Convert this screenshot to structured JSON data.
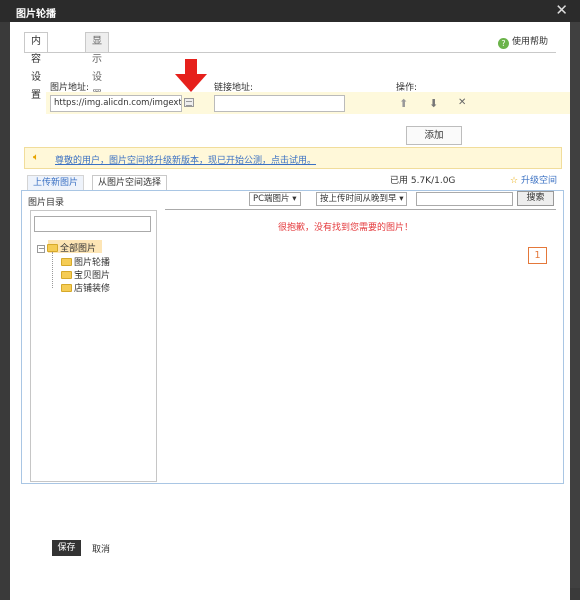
{
  "window": {
    "title": "图片轮播",
    "close_glyph": "✕"
  },
  "tabs": [
    {
      "label": "内容设置",
      "active": true
    },
    {
      "label": "显示设置",
      "active": false
    }
  ],
  "help": {
    "label": "使用帮助",
    "icon": "question-circle-icon"
  },
  "form": {
    "image_url_label": "图片地址:",
    "image_url_value": "https://img.alicdn.com/imgextra/",
    "link_url_label": "链接地址:",
    "link_url_value": "",
    "ops_label": "操作:",
    "ops": [
      {
        "name": "move-up",
        "glyph": "⬆"
      },
      {
        "name": "move-down",
        "glyph": "⬇"
      },
      {
        "name": "delete",
        "glyph": "✕"
      }
    ]
  },
  "add_button": "添加",
  "notice": {
    "text": "尊敬的用户，图片空间将升级新版本，现已开始公测，点击试用。",
    "icon": "speaker-icon"
  },
  "library_tabs": [
    {
      "label": "上传新图片",
      "active": false
    },
    {
      "label": "从图片空间选择",
      "active": true
    }
  ],
  "usage": "已用 5.7K/1.0G",
  "upgrade": {
    "star": "☆",
    "label": "升级空间"
  },
  "directory": {
    "title": "图片目录",
    "search_value": "",
    "root": {
      "toggle": "−",
      "label": "全部图片"
    },
    "children": [
      "图片轮播",
      "宝贝图片",
      "店铺装修"
    ]
  },
  "filters": {
    "device": "PC端图片 ▾",
    "sort": "按上传时间从晚到早 ▾",
    "search_value": "",
    "search_button": "搜索"
  },
  "results": {
    "empty_message": "很抱歉，没有找到您需要的图片！",
    "page": "1"
  },
  "footer": {
    "save": "保存",
    "cancel": "取消"
  },
  "colors": {
    "annotation_arrow": "#e6201b",
    "notice_link": "#3b71c3",
    "error_text": "#e4393c"
  }
}
